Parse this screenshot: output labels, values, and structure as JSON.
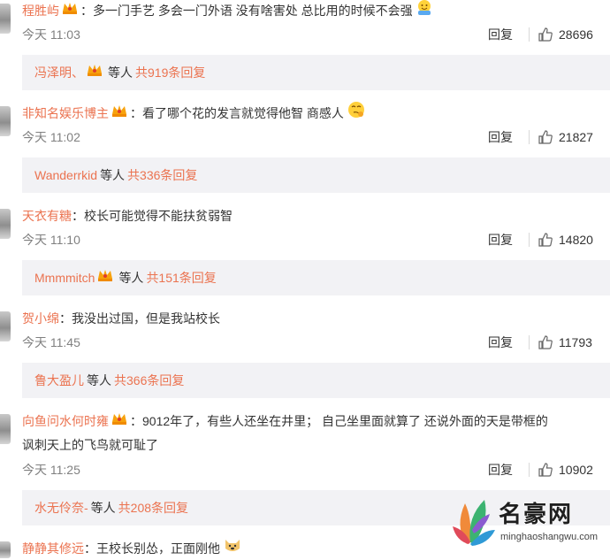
{
  "comments": [
    {
      "user": "程胜屿",
      "text": "：多一门手艺 多会一门外语 没有啥害处 总比用的时候不会强",
      "time": "今天 11:03",
      "reply_label": "回复",
      "likes": "28696",
      "thread": {
        "user": "冯泽明、",
        "etc": "等人",
        "count": "共919条回复"
      }
    },
    {
      "user": "非知名娱乐博主",
      "text": "：看了哪个花的发言就觉得他智 商感人",
      "time": "今天 11:02",
      "reply_label": "回复",
      "likes": "21827",
      "thread": {
        "user": "Wanderrkid",
        "etc": "等人",
        "count": "共336条回复"
      }
    },
    {
      "user": "天衣有糖",
      "text": "：校长可能觉得不能扶贫弱智",
      "time": "今天 11:10",
      "reply_label": "回复",
      "likes": "14820",
      "thread": {
        "user": "Mmmmitch",
        "etc": "等人",
        "count": "共151条回复"
      }
    },
    {
      "user": "贺小绵",
      "text": "：我没出过国，但是我站校长",
      "time": "今天 11:45",
      "reply_label": "回复",
      "likes": "11793",
      "thread": {
        "user": "鲁大盈儿",
        "etc": "等人",
        "count": "共366条回复"
      }
    },
    {
      "user": "向鱼问水何时雍",
      "text": "：9012年了，有些人还坐在井里； 自己坐里面就算了 还说外面的天是带框的",
      "text2": "讽刺天上的飞鸟就可耻了",
      "time": "今天 11:25",
      "reply_label": "回复",
      "likes": "10902",
      "thread": {
        "user": "水无伶奈-",
        "etc": "等人",
        "count": "共208条回复"
      }
    },
    {
      "user": "静静其修远",
      "text": "：王校长别怂，正面刚他"
    }
  ],
  "watermark": {
    "name": "名豪网",
    "url": "minghaoshangwu.com"
  },
  "colors": {
    "username": "#eb7350",
    "reply_bg": "#f2f2f5",
    "meta": "#808080"
  }
}
